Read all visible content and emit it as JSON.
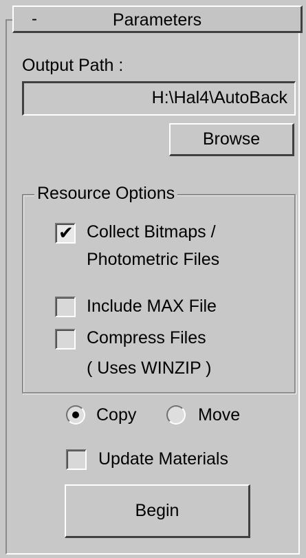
{
  "rollout": {
    "collapse_symbol": "-",
    "title": "Parameters"
  },
  "output": {
    "label": "Output Path :",
    "path_value": "H:\\Hal4\\AutoBack",
    "browse_label": "Browse"
  },
  "resource_options": {
    "group_label": "Resource Options",
    "collect_bitmaps": {
      "label_line1": "Collect Bitmaps /",
      "label_line2": "Photometric Files",
      "checked": true,
      "check_glyph": "✔"
    },
    "include_max_file": {
      "label": "Include MAX File",
      "checked": false
    },
    "compress_files": {
      "label": "Compress Files",
      "note": "( Uses WINZIP )",
      "checked": false
    }
  },
  "mode": {
    "copy_label": "Copy",
    "move_label": "Move",
    "selected": "Copy"
  },
  "update_materials": {
    "label": "Update Materials",
    "checked": false
  },
  "begin_label": "Begin"
}
